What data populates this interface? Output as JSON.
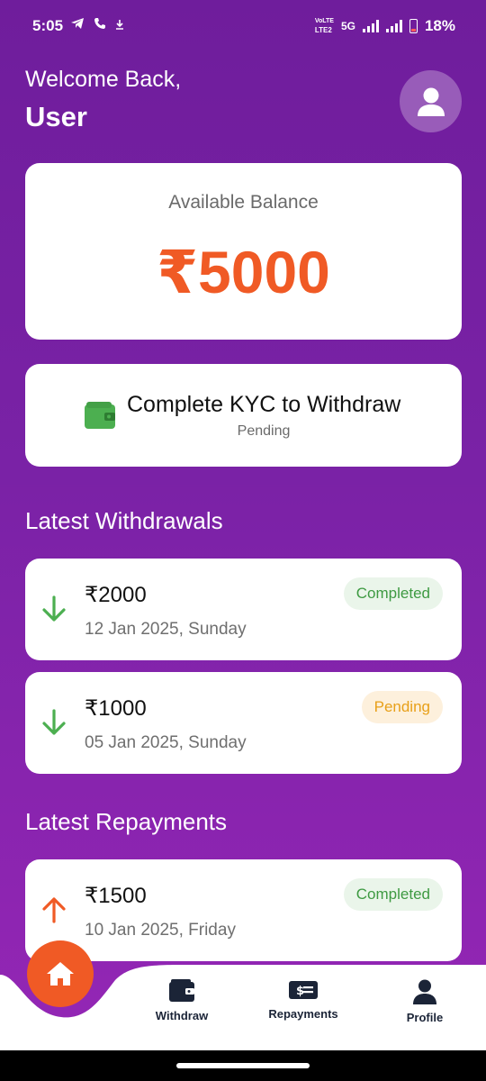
{
  "status_bar": {
    "time": "5:05",
    "network_top": "VoLTE",
    "network_bottom": "LTE2",
    "network_type": "5G",
    "battery_percent": "18%"
  },
  "header": {
    "greeting": "Welcome Back,",
    "user_name": "User",
    "avatar_icon": "person-icon"
  },
  "balance": {
    "label": "Available Balance",
    "amount": "₹5000",
    "amount_color": "#f05a25"
  },
  "kyc": {
    "icon": "wallet-icon",
    "title": "Complete KYC to Withdraw",
    "status": "Pending",
    "icon_color": "#4caf50"
  },
  "withdrawals": {
    "title": "Latest Withdrawals",
    "items": [
      {
        "amount": "₹2000",
        "date": "12 Jan 2025, Sunday",
        "status": "Completed",
        "direction": "down"
      },
      {
        "amount": "₹1000",
        "date": "05 Jan 2025, Sunday",
        "status": "Pending",
        "direction": "down"
      }
    ]
  },
  "repayments": {
    "title": "Latest Repayments",
    "items": [
      {
        "amount": "₹1500",
        "date": "10 Jan 2025, Friday",
        "status": "Completed",
        "direction": "up"
      }
    ]
  },
  "bottom_nav": {
    "home_icon": "home-icon",
    "items": [
      {
        "label": "Withdraw",
        "icon": "wallet-icon"
      },
      {
        "label": "Repayments",
        "icon": "money-bill-icon"
      },
      {
        "label": "Profile",
        "icon": "person-icon"
      }
    ]
  },
  "colors": {
    "primary_gradient_top": "#6f1d9c",
    "primary_gradient_bottom": "#9426b5",
    "accent": "#f05a25",
    "completed": "#3e9a42",
    "pending": "#e8a019",
    "arrow_down": "#4caf50",
    "arrow_up": "#f05a25"
  }
}
